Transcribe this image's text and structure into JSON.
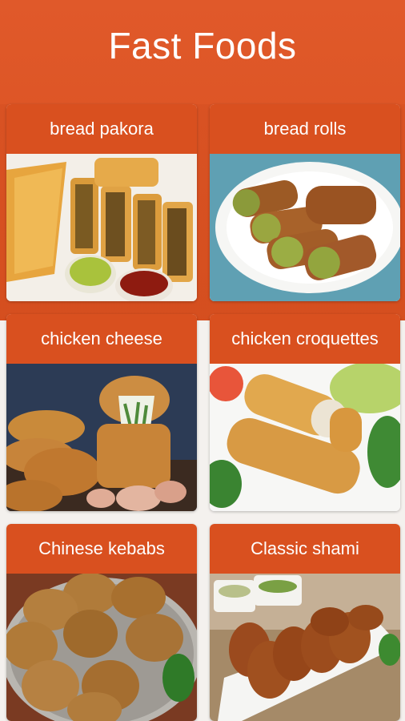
{
  "header": {
    "title": "Fast Foods"
  },
  "items": [
    {
      "label": "bread pakora",
      "icon": "bread-pakora-photo"
    },
    {
      "label": "bread rolls",
      "icon": "bread-rolls-photo"
    },
    {
      "label": "chicken cheese",
      "icon": "chicken-cheese-photo"
    },
    {
      "label": "chicken croquettes",
      "icon": "chicken-croquettes-photo"
    },
    {
      "label": "Chinese kebabs",
      "icon": "chinese-kebabs-photo"
    },
    {
      "label": "Classic shami",
      "icon": "classic-shami-photo"
    }
  ],
  "colors": {
    "accent": "#d9501f",
    "header": "#e0592a",
    "card_bg": "#ffffff"
  }
}
